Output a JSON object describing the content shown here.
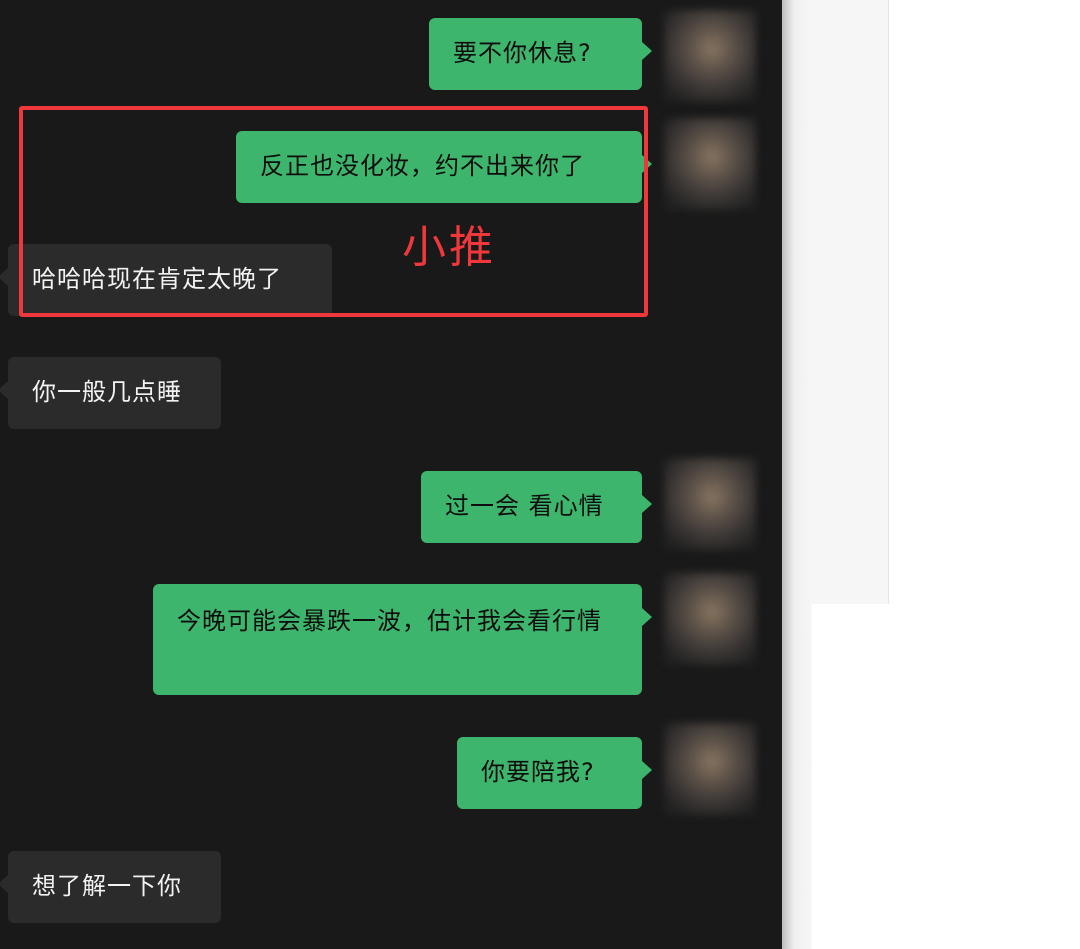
{
  "messages": [
    {
      "direction": "outgoing",
      "text": "要不你休息?"
    },
    {
      "direction": "outgoing",
      "text": "反正也没化妆，约不出来你了"
    },
    {
      "direction": "incoming",
      "text": "哈哈哈现在肯定太晚了"
    },
    {
      "direction": "incoming",
      "text": "你一般几点睡"
    },
    {
      "direction": "outgoing",
      "text": "过一会 看心情"
    },
    {
      "direction": "outgoing",
      "text": "今晚可能会暴跌一波，估计我会看行情"
    },
    {
      "direction": "outgoing",
      "text": "你要陪我?"
    },
    {
      "direction": "incoming",
      "text": "想了解一下你"
    }
  ],
  "annotation": {
    "label": "小推",
    "color": "#f0373b"
  },
  "colors": {
    "chat_background": "#191919",
    "outgoing_bubble": "#3eb56c",
    "incoming_bubble": "#2b2b2b"
  }
}
